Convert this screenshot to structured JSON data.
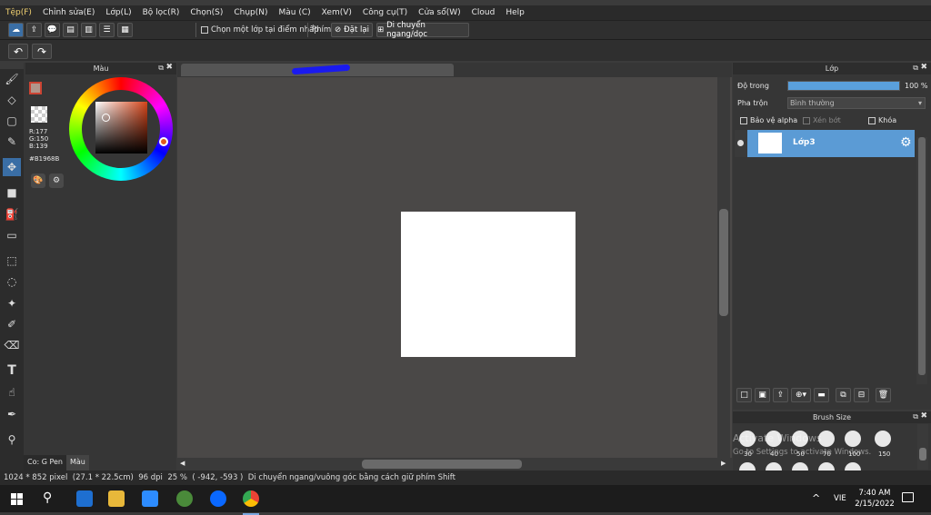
{
  "menu": [
    "Tệp(F)",
    "Chỉnh sửa(E)",
    "Lớp(L)",
    "Bộ lọc(R)",
    "Chọn(S)",
    "Chụp(N)",
    "Màu (C)",
    "Xem(V)",
    "Công cụ(T)",
    "Cửa sổ(W)",
    "Cloud",
    "Help"
  ],
  "toolbar": {
    "select_clicked_layer": "Chọn một lớp tại điểm nhấp",
    "key_label": "Phím",
    "reset_label": "Đặt lại",
    "move_hv_label": "Di chuyển ngang/dọc"
  },
  "color_panel": {
    "title": "Màu",
    "r": "R:177",
    "g": "G:150",
    "b": "B:139",
    "hex": "#B1968B",
    "primary_color": "#B1968B",
    "bottom_tabs": [
      "Co: G Pen",
      "Màu"
    ]
  },
  "layer_panel": {
    "title": "Lớp",
    "opacity_label": "Độ trong",
    "opacity_value": "100 %",
    "opacity_fraction": 1.0,
    "blend_label": "Pha trộn",
    "blend_value": "Bình thường",
    "protect_alpha": "Bảo vệ alpha",
    "clip": "Xén bớt",
    "lock": "Khóa",
    "layer_name": "Lớp3"
  },
  "brush_panel": {
    "title": "Brush Size",
    "sizes": [
      "30",
      "40",
      "50",
      "70",
      "100",
      "150"
    ]
  },
  "watermark": {
    "line1": "Activate Windows",
    "line2": "Go to Settings to activate Windows."
  },
  "status": {
    "size": "1024 * 852 pixel",
    "cm": "(27.1 * 22.5cm)",
    "dpi": "96 dpi",
    "zoom": "25 %",
    "coords": "( -942, -593 )",
    "hint": "Di chuyển ngang/vuông góc bằng cách giữ phím Shift"
  },
  "taskbar": {
    "lang": "VIE",
    "time": "7:40 AM",
    "date": "2/15/2022"
  }
}
